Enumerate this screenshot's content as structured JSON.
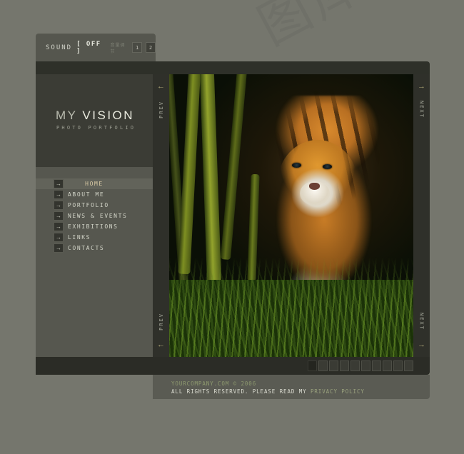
{
  "site": {
    "background_color": "#75766d",
    "accent_color": "#b0a878",
    "watermark_text": "图库"
  },
  "sound_bar": {
    "label": "SOUND",
    "state": "[ OFF ]",
    "sub_label": "音量调节",
    "buttons": [
      {
        "label": "1"
      },
      {
        "label": "2"
      }
    ]
  },
  "logo": {
    "title_part1": "MY ",
    "title_part2": "VISION",
    "subtitle": "PHOTO PORTFOLIO"
  },
  "nav": {
    "items": [
      {
        "label": "HOME",
        "arrow": "→",
        "active": true
      },
      {
        "label": "ABOUT ME",
        "arrow": "→",
        "active": false
      },
      {
        "label": "PORTFOLIO",
        "arrow": "→",
        "active": false
      },
      {
        "label": "NEWS & EVENTS",
        "arrow": "→",
        "active": false
      },
      {
        "label": "EXHIBITIONS",
        "arrow": "→",
        "active": false
      },
      {
        "label": "LINKS",
        "arrow": "→",
        "active": false
      },
      {
        "label": "CONTACTS",
        "arrow": "→",
        "active": false
      }
    ]
  },
  "gallery": {
    "prev_label": "PREV",
    "next_label": "NEXT",
    "prev_arrow": "←",
    "next_arrow": "→",
    "image_alt": "Sumatran tiger walking through grass and bamboo",
    "thumbnail_count": 10,
    "active_thumbnail": 1
  },
  "footer": {
    "line1": "YOURCOMPANY.COM © 2006",
    "line2_prefix": "ALL RIGHTS RESERVED. PLEASE READ MY ",
    "line2_link": "PRIVACY POLICY"
  }
}
